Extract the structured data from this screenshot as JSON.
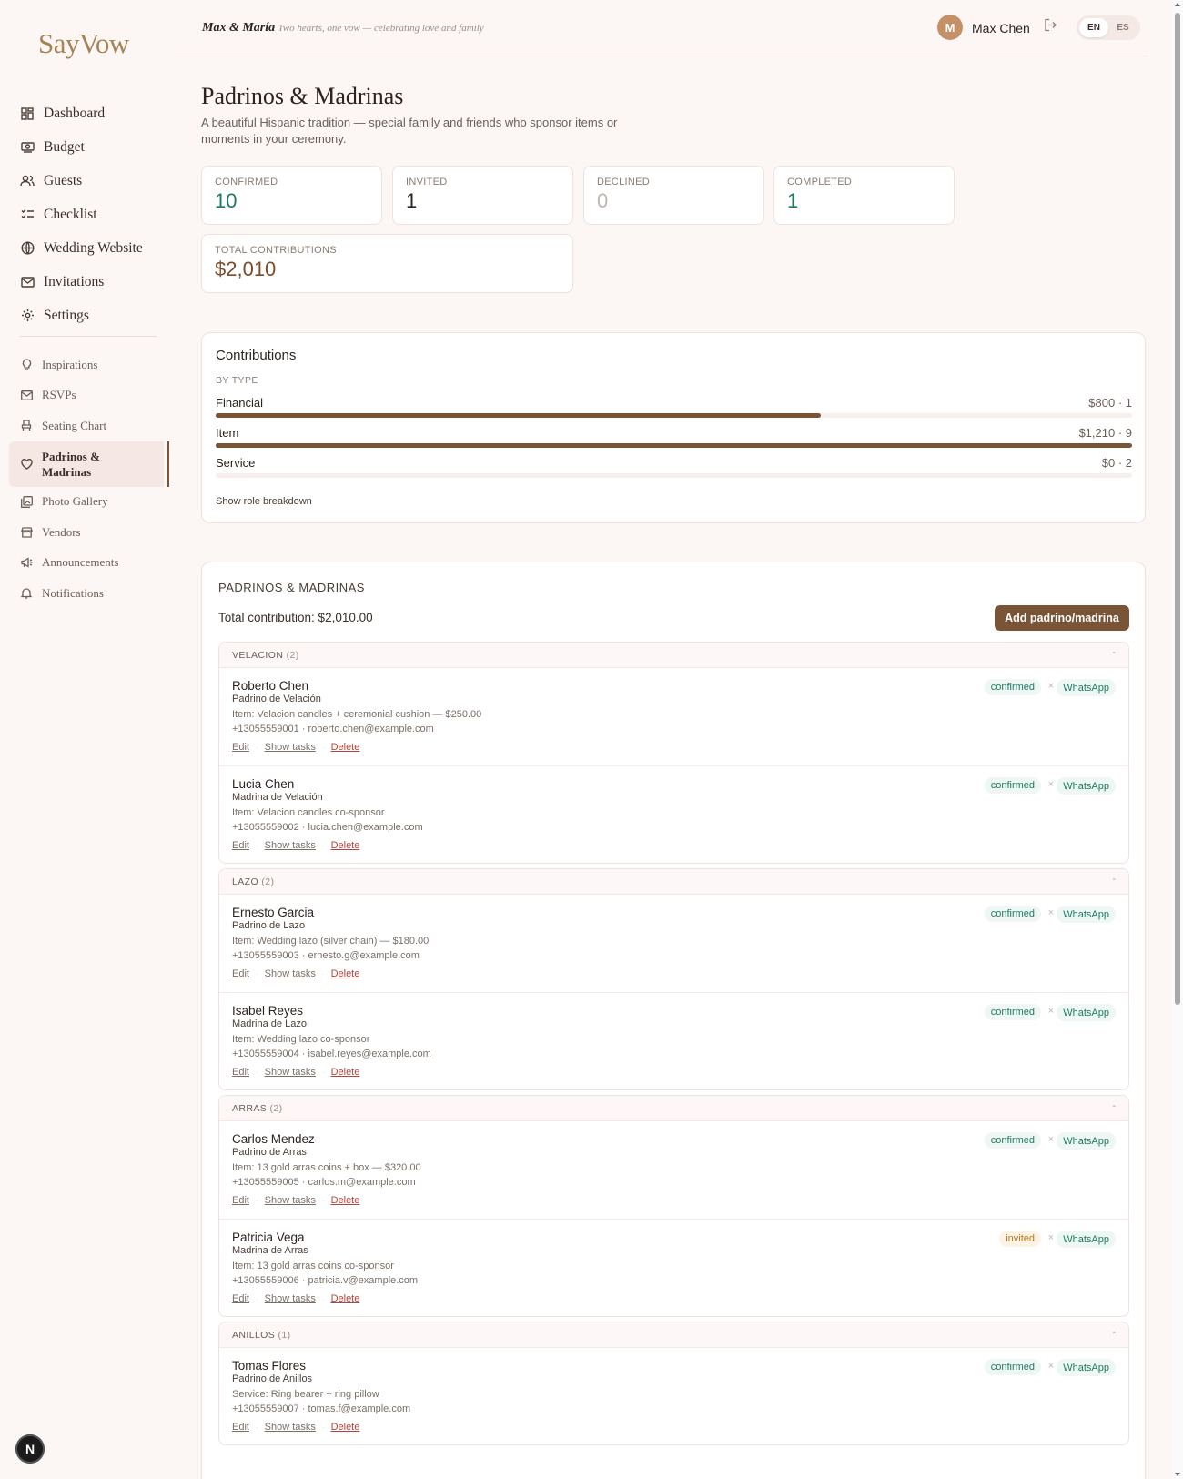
{
  "app": {
    "logo": "SayVow"
  },
  "header": {
    "couple": "Max & María",
    "tagline": "· Two hearts, one vow — celebrating love and family",
    "user_initial": "M",
    "user_name": "Max Chen",
    "lang_en": "EN",
    "lang_es": "ES"
  },
  "sidebar": {
    "primary": [
      {
        "label": "Dashboard",
        "icon": "dashboard-icon"
      },
      {
        "label": "Budget",
        "icon": "money-icon"
      },
      {
        "label": "Guests",
        "icon": "users-icon"
      },
      {
        "label": "Checklist",
        "icon": "checklist-icon"
      },
      {
        "label": "Wedding Website",
        "icon": "globe-icon"
      },
      {
        "label": "Invitations",
        "icon": "mail-icon"
      },
      {
        "label": "Settings",
        "icon": "gear-icon"
      }
    ],
    "secondary": [
      {
        "label": "Inspirations",
        "icon": "lightbulb-icon"
      },
      {
        "label": "RSVPs",
        "icon": "mail-icon"
      },
      {
        "label": "Seating Chart",
        "icon": "chair-icon"
      },
      {
        "label": "Padrinos & Madrinas",
        "icon": "heart-icon"
      },
      {
        "label": "Photo Gallery",
        "icon": "gallery-icon"
      },
      {
        "label": "Vendors",
        "icon": "store-icon"
      },
      {
        "label": "Announcements",
        "icon": "megaphone-icon"
      },
      {
        "label": "Notifications",
        "icon": "bell-icon"
      }
    ]
  },
  "page": {
    "title": "Padrinos & Madrinas",
    "subtitle": "A beautiful Hispanic tradition — special family and friends who sponsor items or moments in your ceremony."
  },
  "stats": {
    "confirmed": {
      "label": "CONFIRMED",
      "value": "10"
    },
    "invited": {
      "label": "INVITED",
      "value": "1"
    },
    "declined": {
      "label": "DECLINED",
      "value": "0"
    },
    "completed": {
      "label": "COMPLETED",
      "value": "1"
    },
    "total": {
      "label": "TOTAL CONTRIBUTIONS",
      "value": "$2,010"
    }
  },
  "contributions": {
    "title": "Contributions",
    "by_type": "BY TYPE",
    "rows": [
      {
        "label": "Financial",
        "value": "$800 · 1",
        "fraction": 0.66
      },
      {
        "label": "Item",
        "value": "$1,210 · 9",
        "fraction": 1.0
      },
      {
        "label": "Service",
        "value": "$0 · 2",
        "fraction": 0.0
      }
    ],
    "show_role": "Show role breakdown"
  },
  "list": {
    "heading": "PADRINOS & MADRINAS",
    "total": "Total contribution: $2,010.00",
    "add_button": "Add padrino/madrina",
    "toggle": "-",
    "whatsapp": "WhatsApp",
    "x": "×",
    "edit": "Edit",
    "show_tasks": "Show tasks",
    "delete": "Delete",
    "sep": "·",
    "groups": [
      {
        "name": "VELACION",
        "count": "(2)",
        "people": [
          {
            "name": "Roberto Chen",
            "role": "Padrino de Velación",
            "item": "Item: Velacion candles + ceremonial cushion — $250.00",
            "contact": "+13055559001 · roberto.chen@example.com",
            "status": "confirmed"
          },
          {
            "name": "Lucia Chen",
            "role": "Madrina de Velación",
            "item": "Item: Velacion candles co-sponsor",
            "contact": "+13055559002 · lucia.chen@example.com",
            "status": "confirmed"
          }
        ]
      },
      {
        "name": "LAZO",
        "count": "(2)",
        "people": [
          {
            "name": "Ernesto Garcia",
            "role": "Padrino de Lazo",
            "item": "Item: Wedding lazo (silver chain) — $180.00",
            "contact": "+13055559003 · ernesto.g@example.com",
            "status": "confirmed"
          },
          {
            "name": "Isabel Reyes",
            "role": "Madrina de Lazo",
            "item": "Item: Wedding lazo co-sponsor",
            "contact": "+13055559004 · isabel.reyes@example.com",
            "status": "confirmed"
          }
        ]
      },
      {
        "name": "ARRAS",
        "count": "(2)",
        "people": [
          {
            "name": "Carlos Mendez",
            "role": "Padrino de Arras",
            "item": "Item: 13 gold arras coins + box — $320.00",
            "contact": "+13055559005 · carlos.m@example.com",
            "status": "confirmed"
          },
          {
            "name": "Patricia Vega",
            "role": "Madrina de Arras",
            "item": "Item: 13 gold arras coins co-sponsor",
            "contact": "+13055559006 · patricia.v@example.com",
            "status": "invited"
          }
        ]
      },
      {
        "name": "ANILLOS",
        "count": "(1)",
        "people": [
          {
            "name": "Tomas Flores",
            "role": "Padrino de Anillos",
            "item": "Service: Ring bearer + ring pillow",
            "contact": "+13055559007 · tomas.f@example.com",
            "status": "confirmed"
          }
        ]
      }
    ]
  },
  "floating_badge": "N",
  "colors": {
    "accent": "#7a5437",
    "confirmed": "#1f7a63",
    "invited": "#b8761c",
    "delete": "#b5433a",
    "logo": "#a78456"
  }
}
